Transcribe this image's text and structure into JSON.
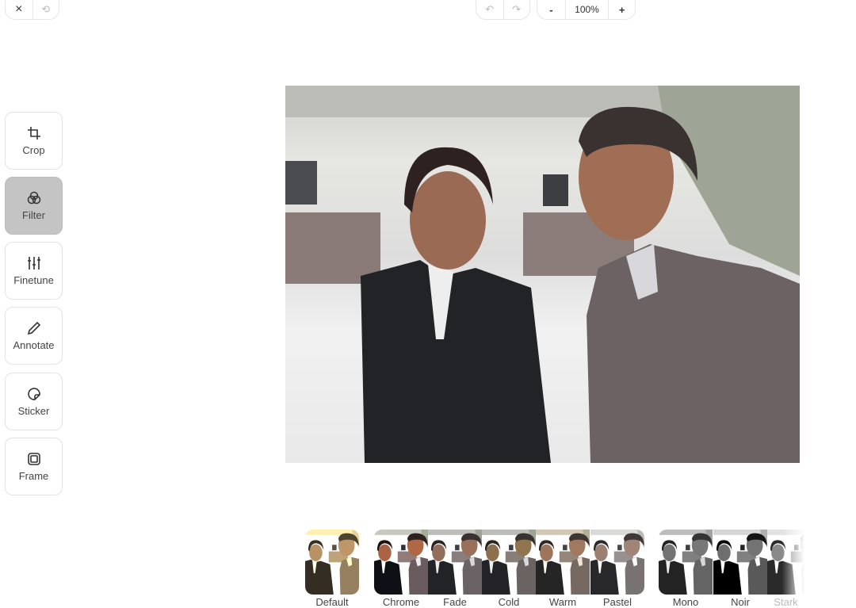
{
  "toolbar": {
    "close": "×",
    "history": "⟲",
    "undo": "↶",
    "redo": "↷",
    "zoom_out": "-",
    "zoom": "100%",
    "zoom_in": "+"
  },
  "tools": [
    {
      "label": "Crop",
      "icon": "crop-icon"
    },
    {
      "label": "Filter",
      "icon": "filter-icon",
      "active": true
    },
    {
      "label": "Finetune",
      "icon": "sliders-icon"
    },
    {
      "label": "Annotate",
      "icon": "pencil-icon"
    },
    {
      "label": "Sticker",
      "icon": "sticker-icon"
    },
    {
      "label": "Frame",
      "icon": "frame-icon"
    }
  ],
  "filters": [
    {
      "label": "Default",
      "selected": true
    },
    {
      "label": "Chrome"
    },
    {
      "label": "Fade"
    },
    {
      "label": "Cold"
    },
    {
      "label": "Warm"
    },
    {
      "label": "Pastel"
    },
    {
      "label": "Mono"
    },
    {
      "label": "Noir"
    },
    {
      "label": "Stark"
    }
  ]
}
